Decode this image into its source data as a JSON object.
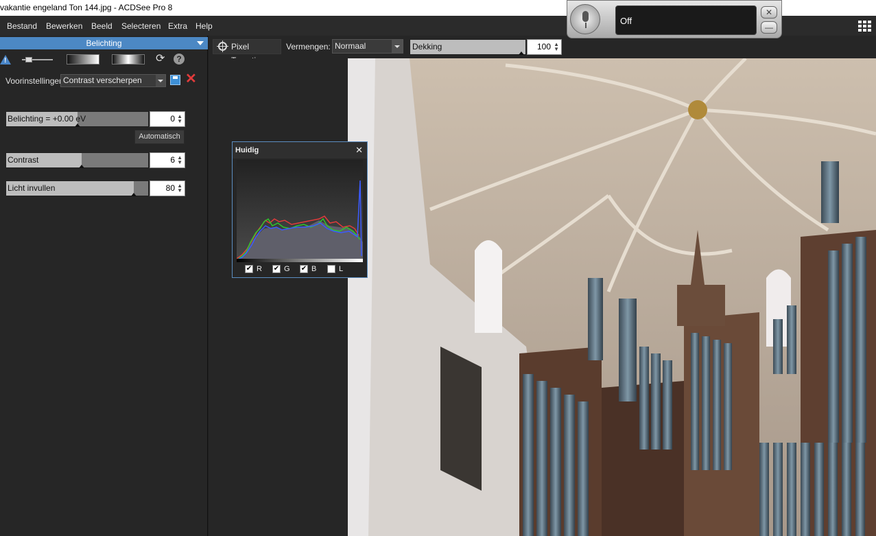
{
  "window": {
    "title": "vakantie engeland Ton 144.jpg - ACDSee Pro 8"
  },
  "menu": [
    "Bestand",
    "Bewerken",
    "Beeld",
    "Selecteren",
    "Extra",
    "Help"
  ],
  "panel": {
    "header": "Belichting",
    "preset_label": "Voorinstellingen",
    "preset_value": "Contrast verscherpen",
    "params": [
      {
        "label": "Belichting = +0.00 eV",
        "value": "0",
        "level": 0.5
      },
      {
        "label": "Contrast",
        "value": "6",
        "level": 0.53
      },
      {
        "label": "Licht invullen",
        "value": "80",
        "level": 0.9
      }
    ],
    "auto_button": "Automatisch"
  },
  "toolbar": {
    "pixel_targeting": "Pixel Targeting",
    "blend_label": "Vermengen:",
    "blend_value": "Normaal",
    "opacity_label": "Dekking",
    "opacity_value": "100"
  },
  "voice": {
    "status": "Off"
  },
  "histogram": {
    "title": "Huidig",
    "channels": [
      {
        "label": "R",
        "checked": true,
        "color": "#e23b3b"
      },
      {
        "label": "G",
        "checked": true,
        "color": "#2ec62e"
      },
      {
        "label": "B",
        "checked": true,
        "color": "#3b5bff"
      },
      {
        "label": "L",
        "checked": false,
        "color": "#ffffff"
      }
    ]
  },
  "icons": [
    "warning-icon",
    "refresh-icon",
    "help-icon",
    "save-icon",
    "delete-icon",
    "crosshair-icon",
    "microphone-icon",
    "grid-view-icon"
  ]
}
